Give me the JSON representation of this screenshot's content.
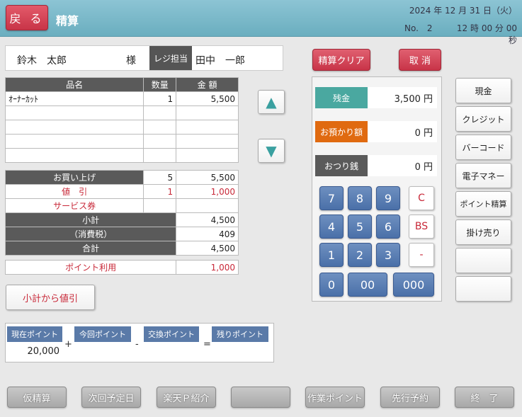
{
  "header": {
    "back": "戻 る",
    "title": "精算",
    "date": "2024 年 12 月 31 日（火）",
    "reg_no": "No.　2",
    "time": "12 時 00 分 00 秒"
  },
  "customer": {
    "name": "鈴木　太郎",
    "honorific": "様",
    "staff_label": "レジ担当",
    "staff_name": "田中　一郎"
  },
  "items": {
    "headers": [
      "品名",
      "数量",
      "金 額"
    ],
    "rows": [
      {
        "name": "ｵｰﾅｰｶｯﾄ",
        "qty": "1",
        "amount": "5,500"
      }
    ]
  },
  "summary": {
    "purchase_label": "お買い上げ",
    "purchase_qty": "5",
    "purchase_amount": "5,500",
    "discount_label": "値　引",
    "discount_qty": "1",
    "discount_amount": "1,000",
    "coupon_label": "サービス券",
    "subtotal_label": "小計",
    "subtotal": "4,500",
    "tax_label": "（消費税）",
    "tax": "409",
    "total_label": "合計",
    "total": "4,500",
    "point_use_label": "ポイント利用",
    "point_use": "1,000"
  },
  "buttons": {
    "discount_from_subtotal": "小計から値引",
    "clear": "精算クリア",
    "cancel": "取 消"
  },
  "payment": {
    "balance_label": "残金",
    "balance": "3,500 円",
    "deposit_label": "お預かり額",
    "deposit": "0 円",
    "change_label": "おつり銭",
    "change": "0 円"
  },
  "keypad": {
    "k7": "7",
    "k8": "8",
    "k9": "9",
    "k4": "4",
    "k5": "5",
    "k6": "6",
    "k1": "1",
    "k2": "2",
    "k3": "3",
    "k0": "0",
    "k00": "00",
    "k000": "000",
    "clear": "C",
    "bs": "BS",
    "minus": "-"
  },
  "methods": [
    "現金",
    "クレジット",
    "バーコード",
    "電子マネー",
    "ポイント精算",
    "掛け売り",
    "",
    ""
  ],
  "points": {
    "current_label": "現在ポイント",
    "current": "20,000",
    "this_label": "今回ポイント",
    "this": "",
    "exchange_label": "交換ポイント",
    "exchange": "",
    "remain_label": "残りポイント",
    "remain": "",
    "plus": "+",
    "minus": "-",
    "equals": "="
  },
  "bottom": [
    "仮精算",
    "次回予定日",
    "楽天Ｐ紹介",
    "",
    "作業ポイント",
    "先行予約",
    "終　了"
  ],
  "colors": {
    "header": "#7ab8c8",
    "accent_red": "#c83448",
    "teal": "#4aa8a0",
    "orange": "#e06a10",
    "dark": "#5a5a5a",
    "key_blue": "#5a80b8"
  }
}
